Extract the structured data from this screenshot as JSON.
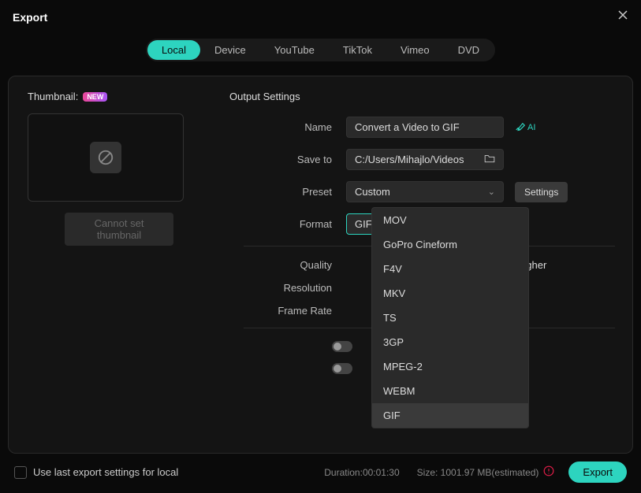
{
  "header": {
    "title": "Export"
  },
  "tabs": {
    "t0": "Local",
    "t1": "Device",
    "t2": "YouTube",
    "t3": "TikTok",
    "t4": "Vimeo",
    "t5": "DVD"
  },
  "thumbnail": {
    "label": "Thumbnail:",
    "badge": "NEW",
    "disabled_btn": "Cannot set thumbnail"
  },
  "output": {
    "section_title": "Output Settings",
    "labels": {
      "name": "Name",
      "save_to": "Save to",
      "preset": "Preset",
      "format": "Format",
      "quality": "Quality",
      "resolution": "Resolution",
      "frame_rate": "Frame Rate"
    },
    "values": {
      "name": "Convert a Video to GIF",
      "save_to": "C:/Users/Mihajlo/Videos",
      "preset": "Custom",
      "format": "GIF",
      "quality_higher": "Higher"
    },
    "settings_btn": "Settings",
    "ai_label": "AI"
  },
  "format_options": {
    "o0": "MOV",
    "o1": "GoPro Cineform",
    "o2": "F4V",
    "o3": "MKV",
    "o4": "TS",
    "o5": "3GP",
    "o6": "MPEG-2",
    "o7": "WEBM",
    "o8": "GIF"
  },
  "footer": {
    "checkbox_label": "Use last export settings for local",
    "duration_label": "Duration:00:01:30",
    "size_label": "Size: 1001.97 MB(estimated)",
    "export_btn": "Export"
  }
}
